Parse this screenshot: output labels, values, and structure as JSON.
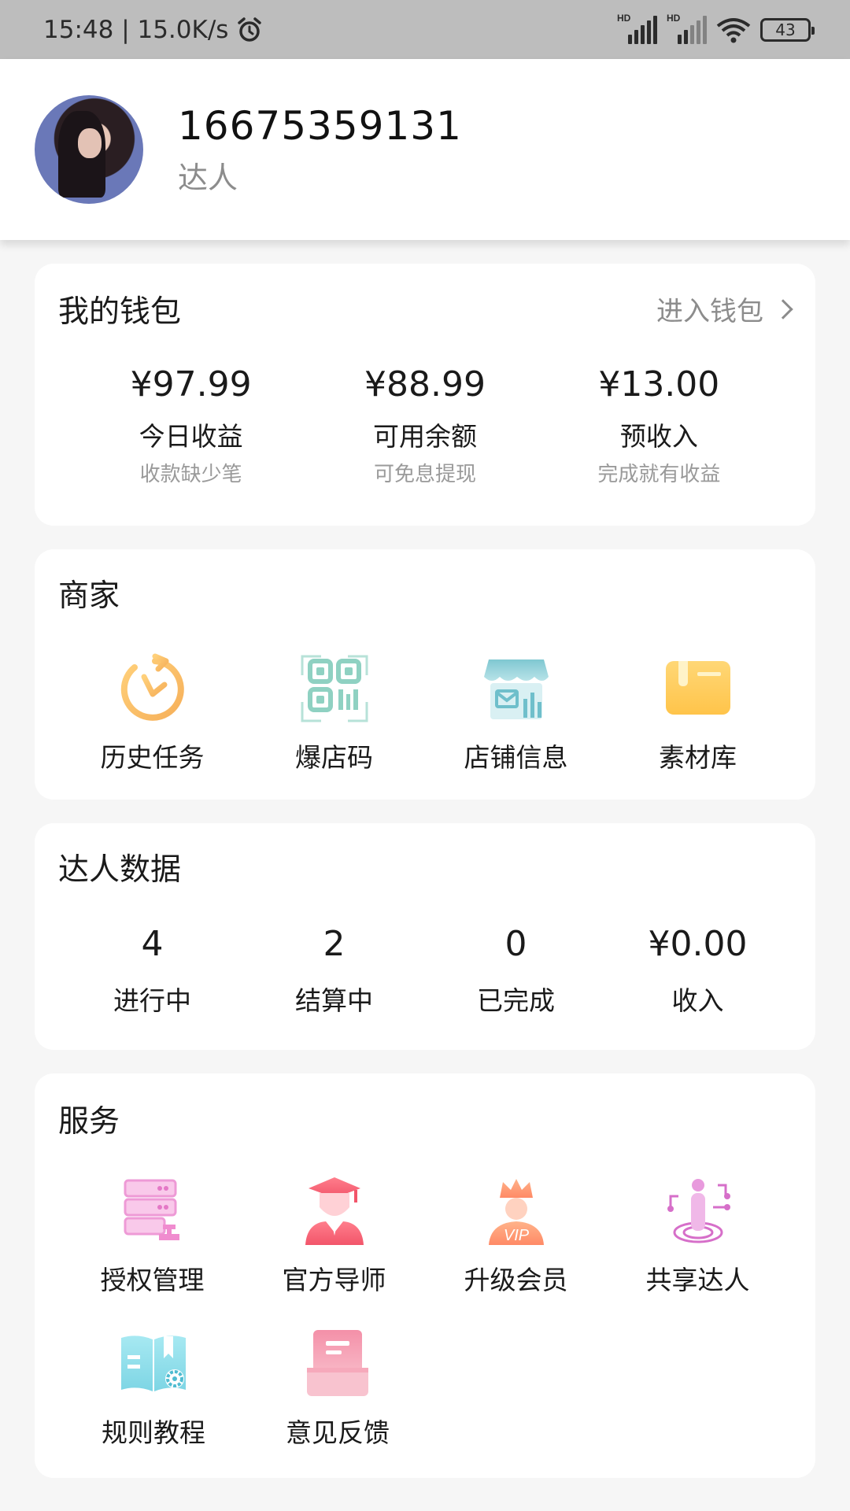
{
  "status_bar": {
    "time_speed": "15:48 | 15.0K/s",
    "alarm_icon": "alarm-icon",
    "signal_icon": "signal-hd-icon",
    "wifi_icon": "wifi-icon",
    "battery": "43"
  },
  "profile": {
    "phone": "16675359131",
    "role": "达人"
  },
  "wallet": {
    "title": "我的钱包",
    "link": "进入钱包",
    "items": [
      {
        "amount": "¥97.99",
        "label": "今日收益",
        "sub": "收款缺少笔"
      },
      {
        "amount": "¥88.99",
        "label": "可用余额",
        "sub": "可免息提现"
      },
      {
        "amount": "¥13.00",
        "label": "预收入",
        "sub": "完成就有收益"
      }
    ]
  },
  "merchant": {
    "title": "商家",
    "items": [
      {
        "label": "历史任务",
        "icon": "clock-icon"
      },
      {
        "label": "爆店码",
        "icon": "qr-code-icon"
      },
      {
        "label": "店铺信息",
        "icon": "store-icon"
      },
      {
        "label": "素材库",
        "icon": "folder-icon"
      }
    ]
  },
  "stats": {
    "title": "达人数据",
    "items": [
      {
        "value": "4",
        "label": "进行中"
      },
      {
        "value": "2",
        "label": "结算中"
      },
      {
        "value": "0",
        "label": "已完成"
      },
      {
        "value": "¥0.00",
        "label": "收入"
      }
    ]
  },
  "service": {
    "title": "服务",
    "items": [
      {
        "label": "授权管理",
        "icon": "server-stamp-icon"
      },
      {
        "label": "官方导师",
        "icon": "graduate-icon"
      },
      {
        "label": "升级会员",
        "icon": "vip-crown-icon"
      },
      {
        "label": "共享达人",
        "icon": "share-person-icon"
      },
      {
        "label": "规则教程",
        "icon": "book-gear-icon"
      },
      {
        "label": "意见反馈",
        "icon": "feedback-box-icon"
      }
    ]
  },
  "colors": {
    "background": "#f6f6f6",
    "card": "#ffffff",
    "status_bar": "#bdbdbd",
    "muted_text": "#8c8c8c"
  }
}
